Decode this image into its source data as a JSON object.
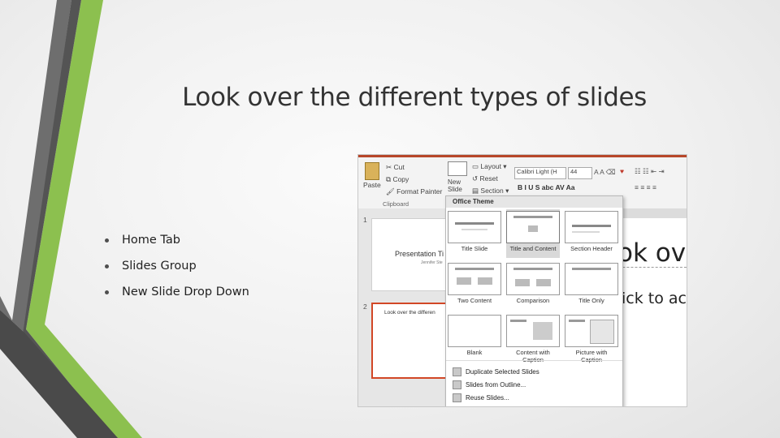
{
  "title": "Look over the different types of slides",
  "bullets": [
    "Home Tab",
    "Slides Group",
    "New Slide Drop Down"
  ],
  "colors": {
    "accent_green": "#7dbb42",
    "dark_gray": "#5a5a5a",
    "ribbon_accent": "#b7472a"
  },
  "ribbon": {
    "cut": "Cut",
    "copy": "Copy",
    "format_painter": "Format Painter",
    "paste": "Paste",
    "clipboard_group": "Clipboard",
    "new_slide": "New Slide",
    "layout": "Layout",
    "reset": "Reset",
    "section": "Section",
    "font_name": "Calibri Light (H",
    "font_size": "44"
  },
  "slide_panel": {
    "slide1_number": "1",
    "slide1_title": "Presentation Ti",
    "slide1_subtitle": "Jennifer Ste",
    "slide2_number": "2",
    "slide2_title": "Look over the differen"
  },
  "slide_canvas": {
    "line1": "ok ov",
    "line2": "ick to ac"
  },
  "dropdown": {
    "header": "Office Theme",
    "layouts": [
      {
        "name": "Title Slide"
      },
      {
        "name": "Title and Content"
      },
      {
        "name": "Section Header"
      },
      {
        "name": "Two Content"
      },
      {
        "name": "Comparison"
      },
      {
        "name": "Title Only"
      },
      {
        "name": "Blank"
      },
      {
        "name": "Content with Caption"
      },
      {
        "name": "Picture with Caption"
      }
    ],
    "menu": [
      "Duplicate Selected Slides",
      "Slides from Outline...",
      "Reuse Slides..."
    ]
  }
}
